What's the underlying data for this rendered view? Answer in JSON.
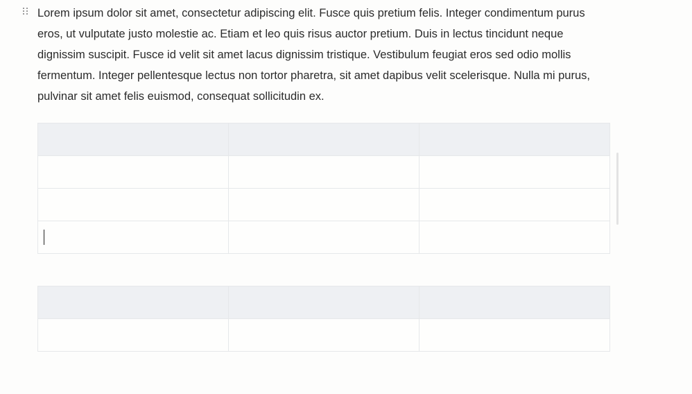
{
  "editor": {
    "paragraph": "Lorem ipsum dolor sit amet, consectetur adipiscing elit. Fusce quis pretium felis. Integer condimentum purus eros, ut vulputate justo molestie ac. Etiam et leo quis risus auctor pretium. Duis in lectus tincidunt neque dignissim suscipit. Fusce id velit sit amet lacus dignissim tristique. Vestibulum feugiat eros sed odio mollis fermentum. Integer pellentesque lectus non tortor pharetra, sit amet dapibus velit scelerisque. Nulla mi purus, pulvinar sit amet felis euismod, consequat sollicitudin ex.",
    "drag_handle_icon": "drag-handle-icon",
    "tables": [
      {
        "rows": [
          [
            "",
            "",
            ""
          ],
          [
            "",
            "",
            ""
          ],
          [
            "",
            "",
            ""
          ],
          [
            "",
            "",
            ""
          ]
        ]
      },
      {
        "rows": [
          [
            "",
            "",
            ""
          ],
          [
            "",
            "",
            ""
          ]
        ]
      }
    ]
  },
  "colors": {
    "page_background": "#fdfdfc",
    "table_header_background": "#eef0f3",
    "table_border": "#e6e8ea",
    "text": "#2b2b2b"
  }
}
